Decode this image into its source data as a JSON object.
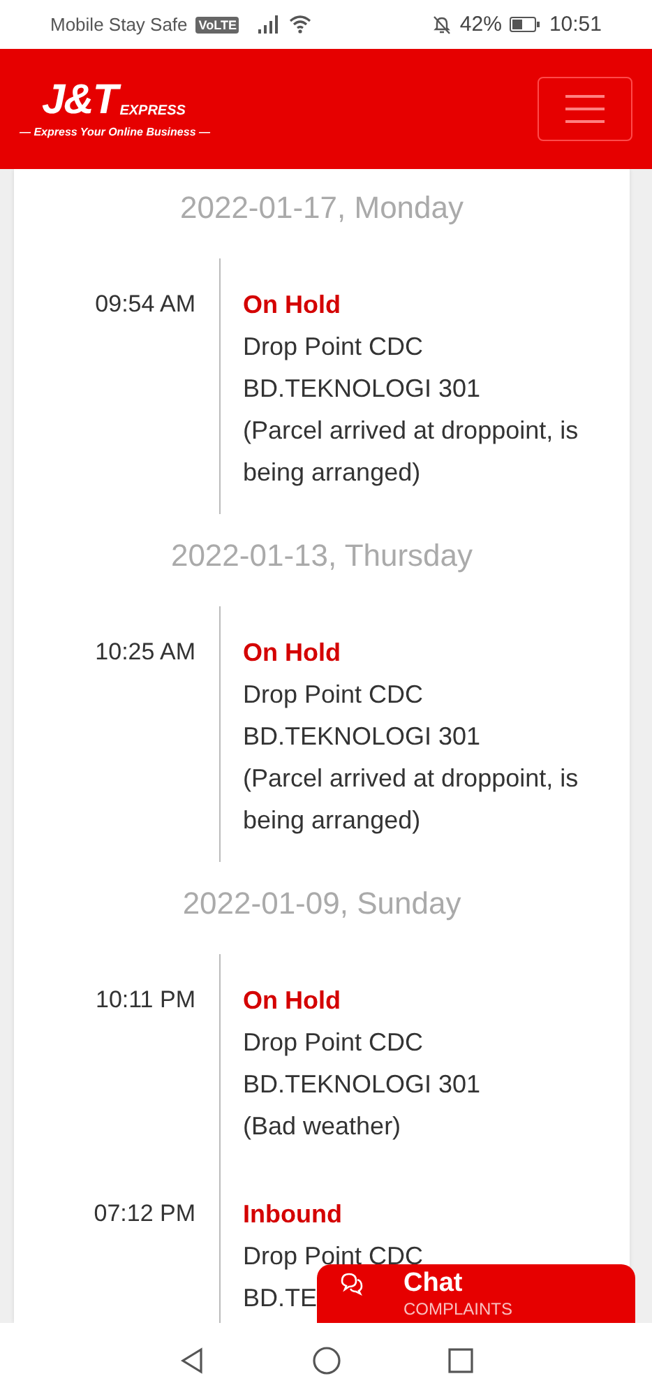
{
  "status_bar": {
    "carrier": "Mobile Stay Safe",
    "network_badge": "VoLTE",
    "battery": "42%",
    "time": "10:51"
  },
  "header": {
    "logo": "J&T",
    "logo_suffix": "EXPRESS",
    "tagline": "— Express Your Online Business —"
  },
  "days": [
    {
      "date": "2022-01-17, Monday",
      "events": [
        {
          "time": "09:54 AM",
          "status": "On Hold",
          "lines": [
            "Drop Point CDC",
            "BD.TEKNOLOGI 301",
            "(Parcel arrived at droppoint, is being arranged)"
          ]
        }
      ]
    },
    {
      "date": "2022-01-13, Thursday",
      "events": [
        {
          "time": "10:25 AM",
          "status": "On Hold",
          "lines": [
            "Drop Point CDC",
            "BD.TEKNOLOGI 301",
            "(Parcel arrived at droppoint, is being arranged)"
          ]
        }
      ]
    },
    {
      "date": "2022-01-09, Sunday",
      "events": [
        {
          "time": "10:11 PM",
          "status": "On Hold",
          "lines": [
            "Drop Point CDC",
            "BD.TEKNOLOGI 301",
            "(Bad weather)"
          ]
        },
        {
          "time": "07:12 PM",
          "status": "Inbound",
          "lines": [
            "Drop Point CDC",
            "BD.TE"
          ]
        }
      ]
    }
  ],
  "chat_button": {
    "label": "Chat",
    "sublabel": "COMPLAINTS"
  }
}
